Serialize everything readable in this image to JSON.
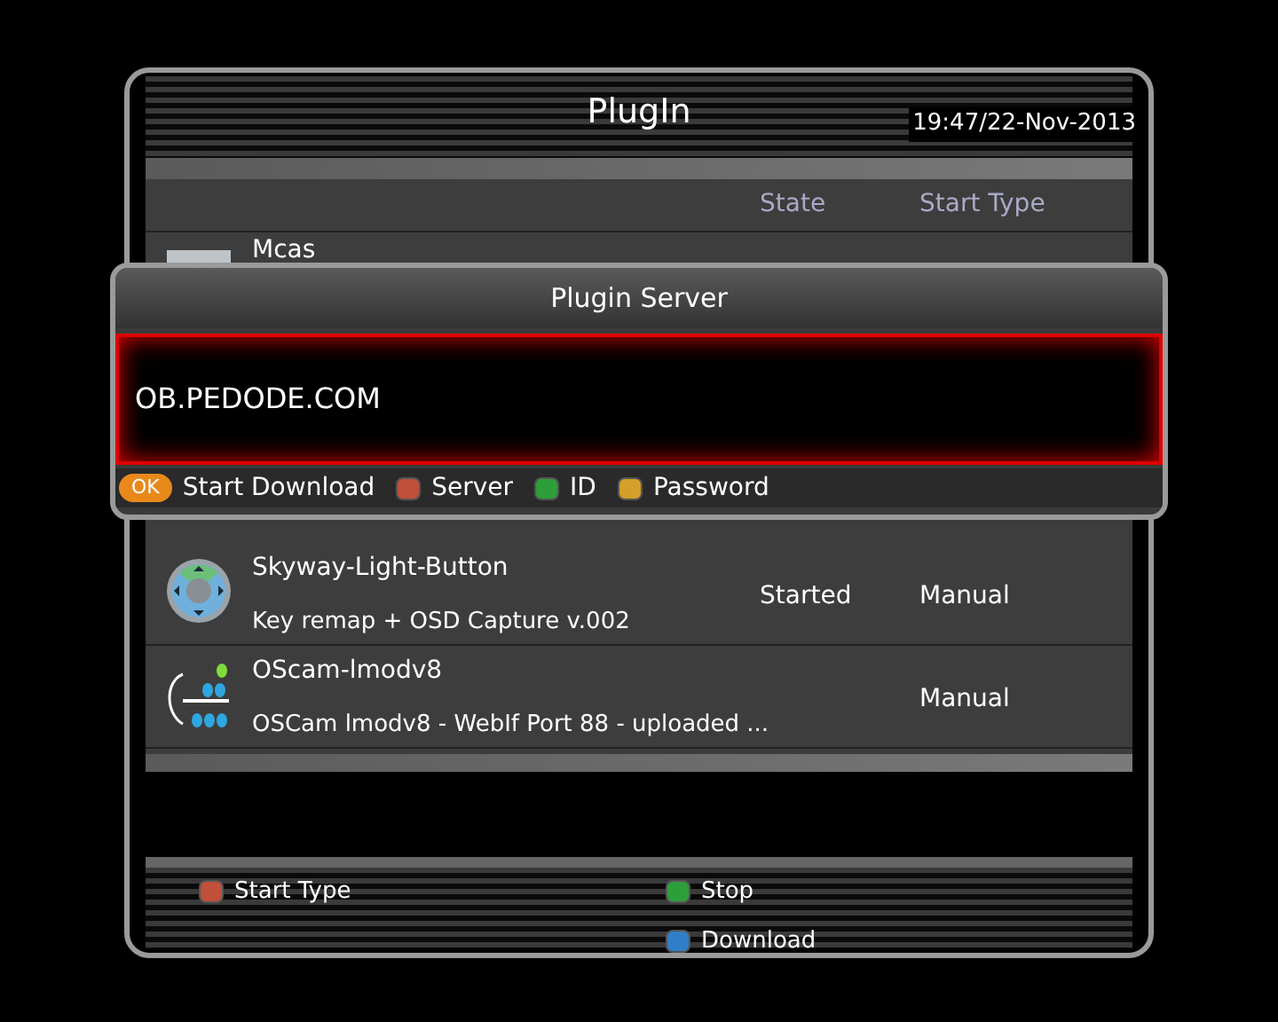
{
  "window": {
    "title": "PlugIn",
    "clock": "19:47/22-Nov-2013"
  },
  "table": {
    "columns": [
      "State",
      "Start Type"
    ],
    "rows": [
      {
        "kind": "box",
        "name": "Mcas"
      },
      {
        "kind": "dpad",
        "name": "Skyway-Light-Button",
        "description": "Key remap + OSD Capture v.002",
        "state": "Started",
        "start_type": "Manual"
      },
      {
        "kind": "key",
        "name": "OScam-lmodv8",
        "description": "OSCam lmodv8 - WebIf Port 88 - uploaded ...",
        "start_type": "Manual"
      }
    ]
  },
  "dialog": {
    "title": "Plugin Server",
    "value": "OB.PEDODE.COM",
    "hints": [
      {
        "kind": "ok",
        "key": "OK",
        "label": "Start Download"
      },
      {
        "kind": "color",
        "color": "#c0503a",
        "label": "Server"
      },
      {
        "kind": "color",
        "color": "#2e9e3a",
        "label": "ID"
      },
      {
        "kind": "color",
        "color": "#d4a02a",
        "label": "Password"
      }
    ]
  },
  "footer": {
    "buttons": [
      {
        "color": "#c0503a",
        "label": "Start Type"
      },
      {
        "color": "#2e9e3a",
        "label": "Stop"
      },
      {
        "color": "#2f7fc8",
        "label": "Download"
      }
    ]
  }
}
